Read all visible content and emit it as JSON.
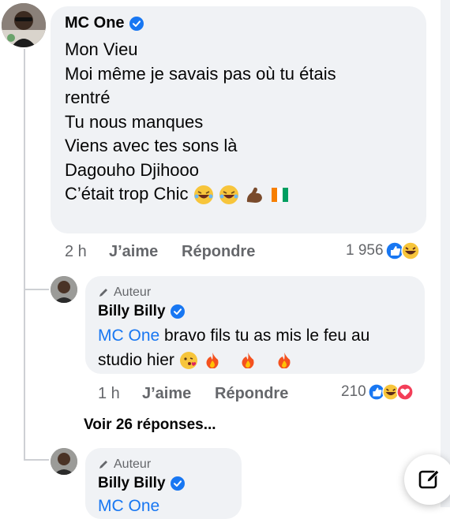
{
  "comment1": {
    "author": "MC One",
    "lines": [
      "Mon Vieu",
      "Moi même je savais pas où tu étais",
      "rentré",
      "Tu nous manques",
      "Viens avec tes sons là",
      "Dagouho Djihooo",
      "C’était trop Chic"
    ],
    "time": "2 h",
    "like_label": "J’aime",
    "reply_label": "Répondre",
    "reaction_count": "1 956"
  },
  "reply1": {
    "author_tag": "Auteur",
    "author": "Billy Billy",
    "mention": "MC One",
    "text_line1_rest": " bravo fils tu as mis le feu au",
    "text_line2": "studio hier",
    "time": "1 h",
    "like_label": "J’aime",
    "reply_label": "Répondre",
    "reaction_count": "210"
  },
  "more_replies": "Voir 26 réponses...",
  "reply2": {
    "author_tag": "Auteur",
    "author": "Billy Billy",
    "partial_text": "MC One"
  },
  "colors": {
    "link": "#1877f2",
    "bubble": "#f0f2f5",
    "muted": "#65676b"
  },
  "icons": [
    "verified-icon",
    "pencil-icon",
    "like-reaction-icon",
    "haha-reaction-icon",
    "love-reaction-icon",
    "compose-icon"
  ]
}
